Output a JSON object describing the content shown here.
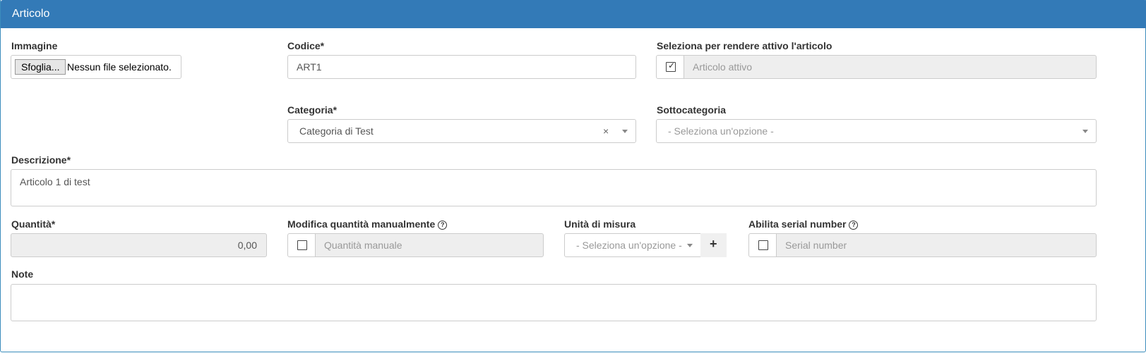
{
  "panel": {
    "title": "Articolo"
  },
  "immagine": {
    "label": "Immagine",
    "button": "Sfoglia...",
    "status": "Nessun file selezionato."
  },
  "codice": {
    "label": "Codice*",
    "value": "ART1"
  },
  "attivo": {
    "label": "Seleziona per rendere attivo l'articolo",
    "checked": true,
    "placeholder": "Articolo attivo"
  },
  "categoria": {
    "label": "Categoria*",
    "value": "Categoria di Test",
    "clear": "×"
  },
  "sottocategoria": {
    "label": "Sottocategoria",
    "placeholder": "- Seleziona un'opzione -"
  },
  "descrizione": {
    "label": "Descrizione*",
    "value": "Articolo 1 di test"
  },
  "quantita": {
    "label": "Quantità*",
    "value": "0,00"
  },
  "quantita_manuale": {
    "label": "Modifica quantità manualmente",
    "checked": false,
    "placeholder": "Quantità manuale",
    "help": "?"
  },
  "unita": {
    "label": "Unità di misura",
    "placeholder": "- Seleziona un'opzione -",
    "add": "+"
  },
  "serial": {
    "label": "Abilita serial number",
    "checked": false,
    "placeholder": "Serial number",
    "help": "?"
  },
  "note": {
    "label": "Note",
    "value": ""
  },
  "colors": {
    "header": "#337ab7",
    "readonly": "#eeeeee",
    "border": "#cccccc"
  }
}
